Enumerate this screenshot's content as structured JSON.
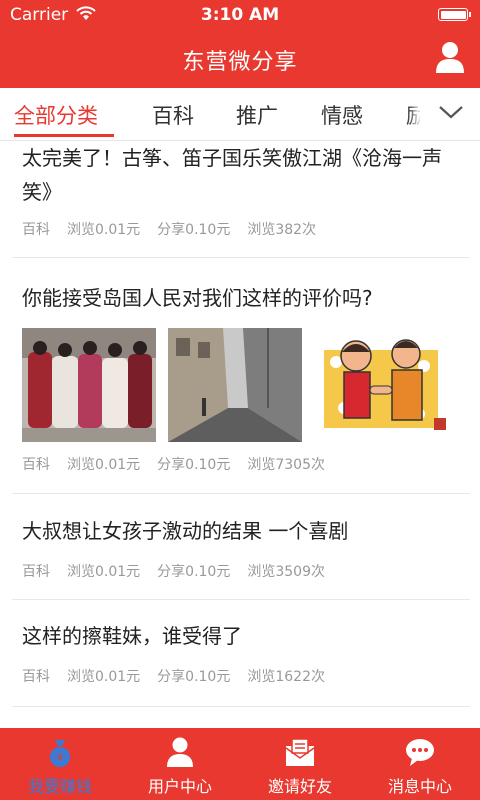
{
  "status_bar": {
    "carrier": "Carrier",
    "time": "3:10 AM"
  },
  "header": {
    "title": "东营微分享"
  },
  "tabs": [
    {
      "label": "全部分类",
      "active": true
    },
    {
      "label": "百科"
    },
    {
      "label": "推广"
    },
    {
      "label": "情感"
    },
    {
      "label": "励"
    }
  ],
  "articles": [
    {
      "title": "太完美了！古筝、笛子国乐笑傲江湖《沧海一声笑》",
      "category": "百科",
      "view_reward": "浏览0.01元",
      "share_reward": "分享0.10元",
      "views": "浏览382次"
    },
    {
      "title": "你能接受岛国人民对我们这样的评价吗?",
      "category": "百科",
      "view_reward": "浏览0.01元",
      "share_reward": "分享0.10元",
      "views": "浏览7305次"
    },
    {
      "title": "大叔想让女孩子激动的结果 一个喜剧",
      "category": "百科",
      "view_reward": "浏览0.01元",
      "share_reward": "分享0.10元",
      "views": "浏览3509次"
    },
    {
      "title": "这样的擦鞋妹，谁受得了",
      "category": "百科",
      "view_reward": "浏览0.01元",
      "share_reward": "分享0.10元",
      "views": "浏览1622次"
    }
  ],
  "bottom_nav": [
    {
      "label": "我要赚钱",
      "active": true
    },
    {
      "label": "用户中心"
    },
    {
      "label": "邀请好友"
    },
    {
      "label": "消息中心"
    }
  ],
  "colors": {
    "brand": "#e8382f",
    "active_nav": "#3a7bd5",
    "meta_text": "#999999"
  }
}
